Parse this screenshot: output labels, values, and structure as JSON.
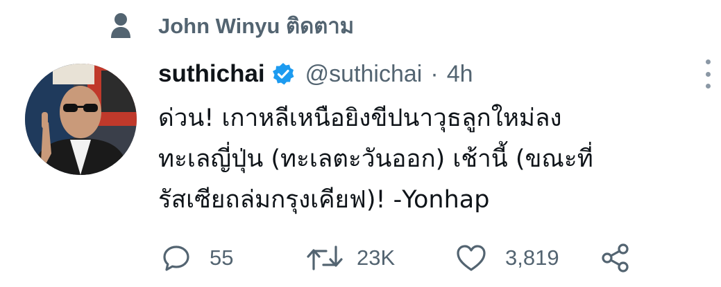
{
  "social_context": {
    "text": "John Winyu ติดตาม",
    "icon": "person-icon"
  },
  "tweet": {
    "author": {
      "name": "suthichai",
      "verified": true,
      "handle": "@suthichai",
      "avatar_icon": "avatar"
    },
    "separator": "·",
    "time": "4h",
    "text_lines": [
      "ด่วน! เกาหลีเหนือยิงขีปนาวุธลูกใหม่ลง",
      "ทะเลญี่ปุ่น (ทะเลตะวันออก) เช้านี้ (ขณะที่",
      "รัสเซียถล่มกรุงเคียฟ)! -Yonhap"
    ],
    "actions": {
      "reply_count": "55",
      "retweet_count": "23K",
      "like_count": "3,819"
    }
  },
  "colors": {
    "verified_blue": "#1d9bf0",
    "secondary_text": "#536471",
    "primary_text": "#0f1419"
  }
}
